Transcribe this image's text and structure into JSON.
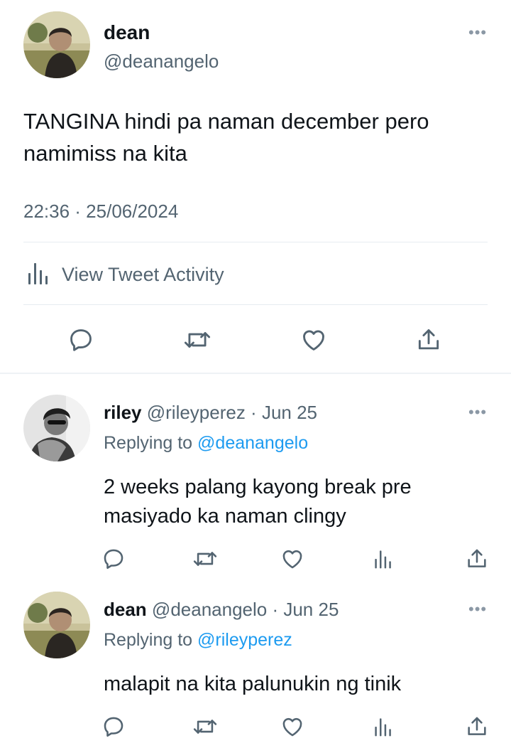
{
  "main_tweet": {
    "name": "dean",
    "handle": "@deanangelo",
    "text": "TANGINA hindi pa naman december pero namimiss na kita",
    "timestamp": "22:36 · 25/06/2024",
    "activity_label": "View Tweet Activity",
    "more_icon": "more-horizontal-icon",
    "actions": [
      "reply-icon",
      "retweet-icon",
      "like-icon",
      "share-icon"
    ]
  },
  "replies": [
    {
      "name": "riley",
      "meta": "@rileyperez · Jun 25",
      "replying_prefix": "Replying to ",
      "replying_to": "@deanangelo",
      "text": "2 weeks palang kayong break pre masiyado ka naman clingy"
    },
    {
      "name": "dean",
      "meta": "@deanangelo · Jun 25",
      "replying_prefix": "Replying to ",
      "replying_to": "@rileyperez",
      "text": "malapit na kita palunukin ng tinik"
    }
  ],
  "colors": {
    "text": "#0f1419",
    "secondary": "#536471",
    "link": "#1d9bf0",
    "divider": "#e6ecf0"
  }
}
